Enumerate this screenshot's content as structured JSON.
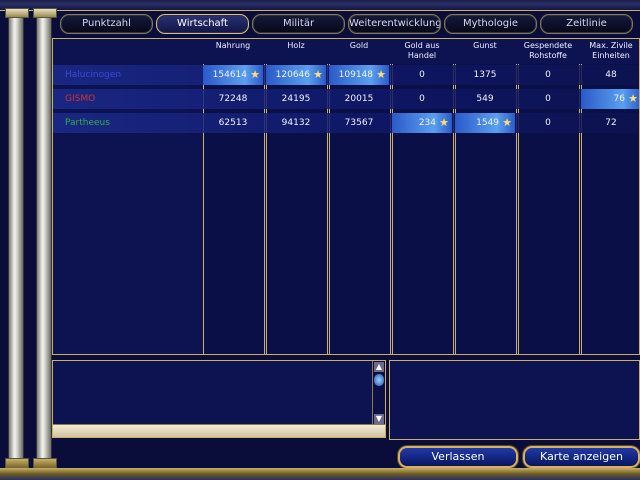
{
  "tabs": [
    {
      "label": "Punktzahl",
      "active": false
    },
    {
      "label": "Wirtschaft",
      "active": true
    },
    {
      "label": "Militär",
      "active": false
    },
    {
      "label": "Weiterentwicklungen",
      "active": false
    },
    {
      "label": "Mythologie",
      "active": false
    },
    {
      "label": "Zeitlinie",
      "active": false
    }
  ],
  "columns": {
    "nahrung": "Nahrung",
    "holz": "Holz",
    "gold": "Gold",
    "gold_handel_1": "Gold aus",
    "gold_handel_2": "Handel",
    "gunst": "Gunst",
    "rohstoffe_1": "Gespendete",
    "rohstoffe_2": "Rohstoffe",
    "zivile_1": "Max. Zivile",
    "zivile_2": "Einheiten"
  },
  "players": [
    {
      "name": "Halucinogen",
      "color": "#3a4ad8",
      "values": [
        "154614",
        "120646",
        "109148",
        "0",
        "1375",
        "0",
        "48"
      ],
      "best": [
        true,
        true,
        true,
        false,
        false,
        false,
        false
      ]
    },
    {
      "name": "GISMO",
      "color": "#d83030",
      "values": [
        "72248",
        "24195",
        "20015",
        "0",
        "549",
        "0",
        "76"
      ],
      "best": [
        false,
        false,
        false,
        false,
        false,
        false,
        true
      ]
    },
    {
      "name": "Partheeus",
      "color": "#30b040",
      "values": [
        "62513",
        "94132",
        "73567",
        "234",
        "1549",
        "0",
        "72"
      ],
      "best": [
        false,
        false,
        false,
        true,
        true,
        false,
        false
      ]
    }
  ],
  "buttons": {
    "leave": "Verlassen",
    "show_map": "Karte anzeigen"
  },
  "colors": {
    "accent_gold": "#c9b066",
    "panel_bg": "#0d1250",
    "highlight": "#5aa0f0"
  }
}
